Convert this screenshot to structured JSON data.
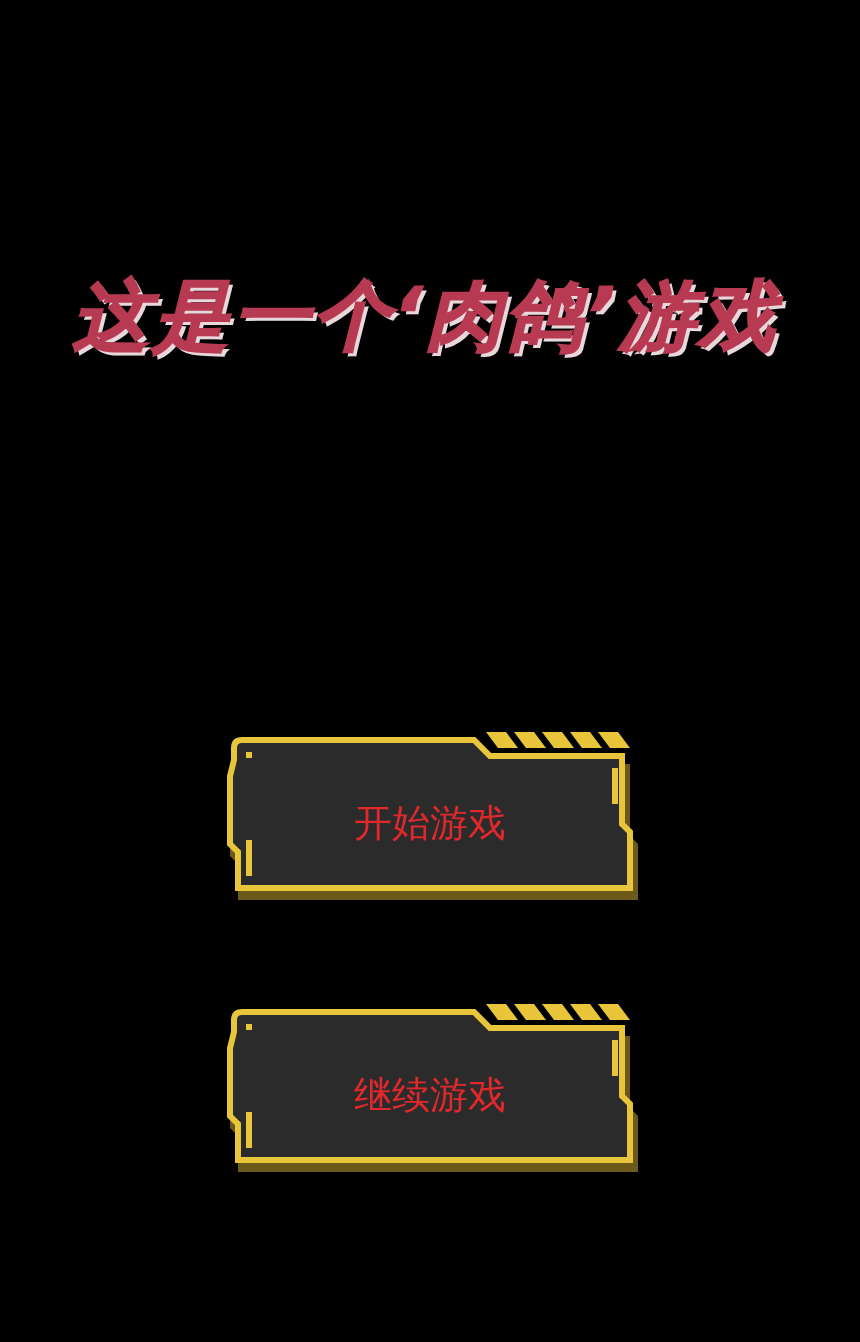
{
  "title": "这是一个‘肉鸽’游戏",
  "buttons": [
    {
      "label": "开始游戏"
    },
    {
      "label": "继续游戏"
    }
  ]
}
